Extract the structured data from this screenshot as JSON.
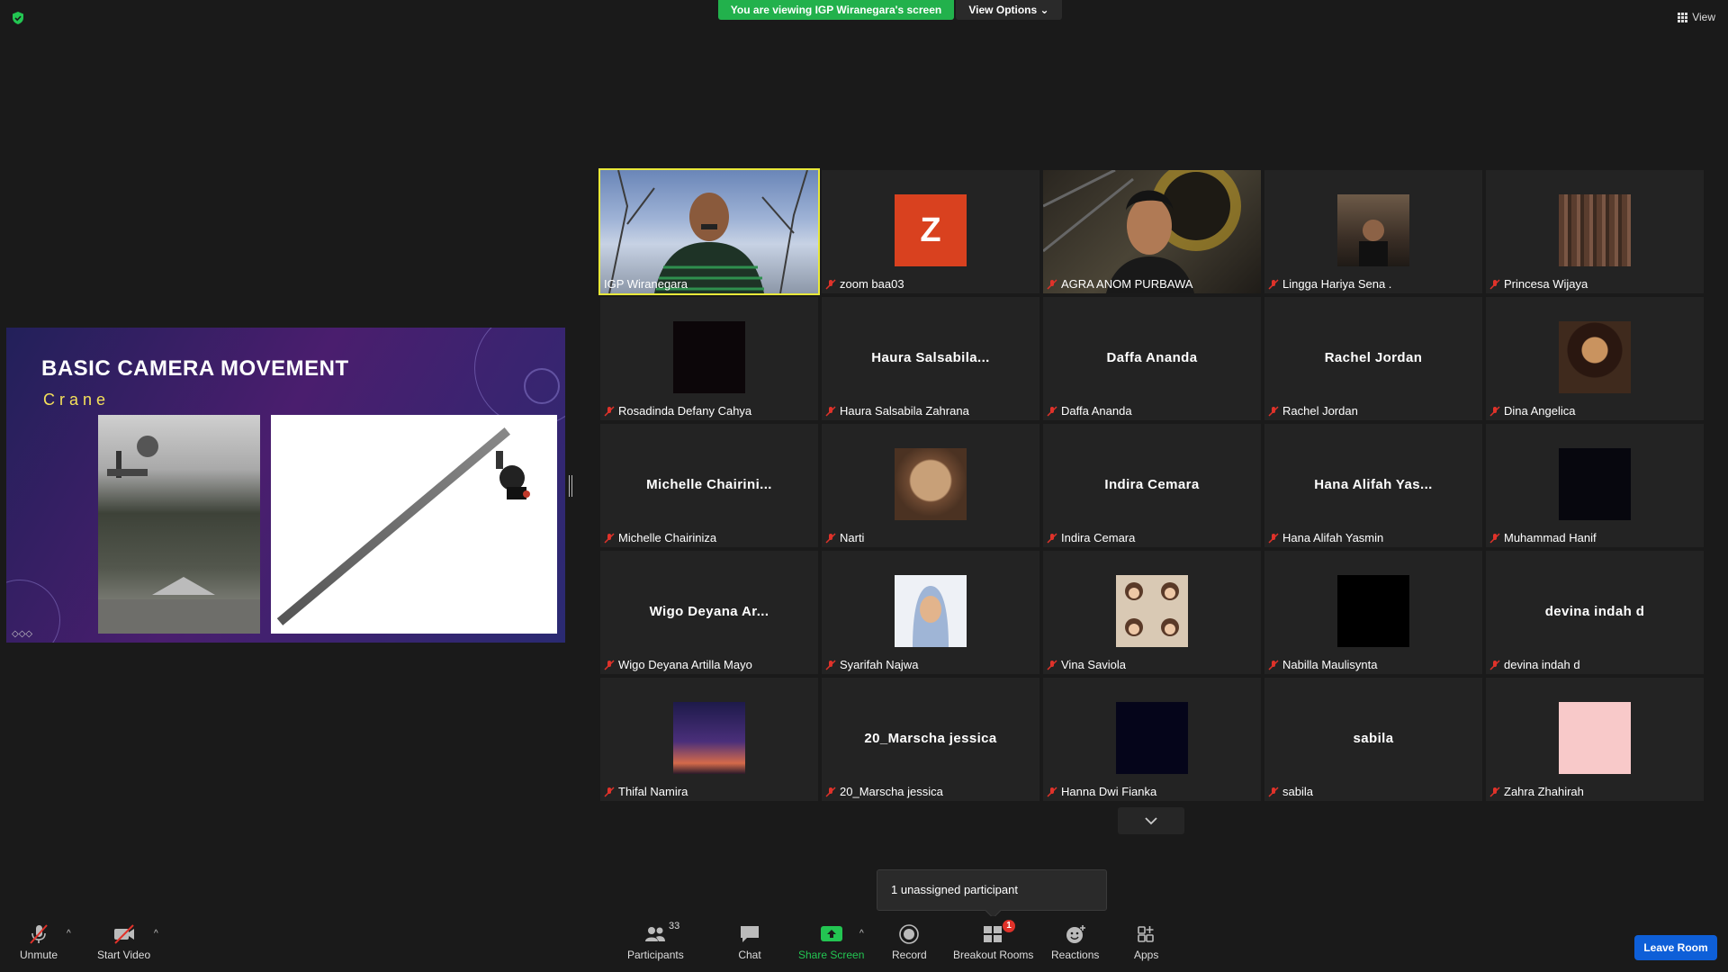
{
  "top_bar": {
    "viewing_banner": "You are viewing IGP Wiranegara's screen",
    "view_options_label": "View Options",
    "view_label": "View"
  },
  "slide": {
    "title": "BASIC CAMERA MOVEMENT",
    "subtitle": "Crane"
  },
  "participants": [
    {
      "name": "IGP Wiranegara",
      "display": "video",
      "muted": false,
      "active": true
    },
    {
      "name": "zoom baa03",
      "display": "avatar",
      "avatar_letter": "Z",
      "muted": true
    },
    {
      "name": "AGRA ANOM PURBAWA",
      "display": "video",
      "muted": true
    },
    {
      "name": "Lingga Hariya Sena .",
      "display": "photo",
      "muted": true
    },
    {
      "name": "Princesa Wijaya",
      "display": "photo",
      "muted": true
    },
    {
      "name": "Rosadinda Defany Cahya",
      "display": "photo",
      "muted": true
    },
    {
      "name": "Haura Salsabila Zahrana",
      "display": "text",
      "big_label": "Haura  Salsabila...",
      "muted": true
    },
    {
      "name": "Daffa Ananda",
      "display": "text",
      "big_label": "Daffa Ananda",
      "muted": true
    },
    {
      "name": "Rachel Jordan",
      "display": "text",
      "big_label": "Rachel Jordan",
      "muted": true
    },
    {
      "name": "Dina Angelica",
      "display": "photo",
      "muted": true
    },
    {
      "name": "Michelle Chairiniza",
      "display": "text",
      "big_label": "Michelle  Chairini...",
      "muted": true
    },
    {
      "name": "Narti",
      "display": "photo",
      "muted": true
    },
    {
      "name": "Indira Cemara",
      "display": "text",
      "big_label": "Indira Cemara",
      "muted": true
    },
    {
      "name": "Hana Alifah Yasmin",
      "display": "text",
      "big_label": "Hana  Alifah  Yas...",
      "muted": true
    },
    {
      "name": "Muhammad Hanif",
      "display": "photo",
      "muted": true
    },
    {
      "name": "Wigo Deyana Artilla Mayo",
      "display": "text",
      "big_label": "Wigo  Deyana  Ar...",
      "muted": true
    },
    {
      "name": "Syarifah Najwa",
      "display": "photo",
      "muted": true
    },
    {
      "name": "Vina Saviola",
      "display": "photo",
      "muted": true
    },
    {
      "name": "Nabilla Maulisynta",
      "display": "photo",
      "muted": true
    },
    {
      "name": "devina indah d",
      "display": "text",
      "big_label": "devina indah d",
      "muted": true
    },
    {
      "name": "Thifal Namira",
      "display": "photo",
      "muted": true
    },
    {
      "name": "20_Marscha jessica",
      "display": "text",
      "big_label": "20_Marscha jessica",
      "muted": true
    },
    {
      "name": "Hanna Dwi Fianka",
      "display": "photo",
      "muted": true
    },
    {
      "name": "sabila",
      "display": "text",
      "big_label": "sabila",
      "muted": true
    },
    {
      "name": "Zahra Zhahirah",
      "display": "photo",
      "muted": true
    }
  ],
  "tooltip": "1 unassigned participant",
  "toolbar": {
    "unmute": "Unmute",
    "start_video": "Start Video",
    "participants": "Participants",
    "participants_count": "33",
    "chat": "Chat",
    "share_screen": "Share Screen",
    "record": "Record",
    "breakout_rooms": "Breakout Rooms",
    "breakout_badge": "1",
    "reactions": "Reactions",
    "apps": "Apps",
    "leave_room": "Leave Room"
  },
  "colors": {
    "accent_green": "#22b14c",
    "active_speaker": "#e8e83a",
    "leave_blue": "#0e5fd8",
    "mute_red": "#e0322a"
  }
}
